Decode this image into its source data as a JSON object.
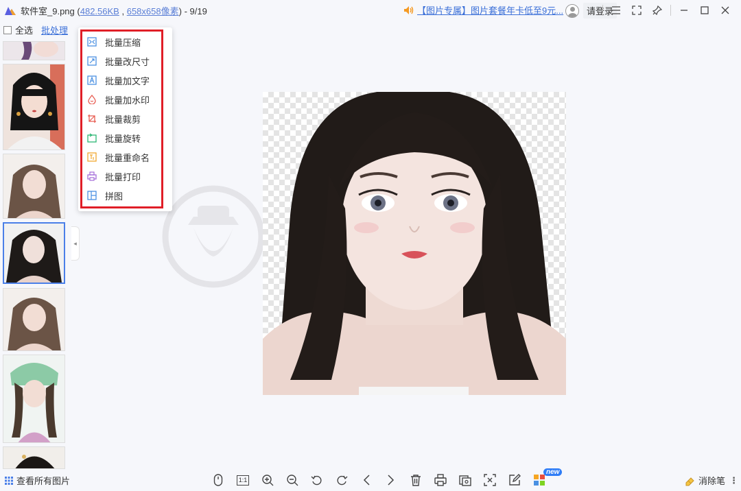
{
  "titlebar": {
    "app_name": "软件室_9.png",
    "paren_open": "(",
    "file_size": "482.56KB",
    "comma": ",",
    "dimensions": "658x658像素",
    "paren_close": ")",
    "position": "- 9/19"
  },
  "promo": {
    "text": "【图片专属】图片套餐年卡低至9元..."
  },
  "account": {
    "login_label": "请登录"
  },
  "sidebar": {
    "select_all_label": "全选",
    "batch_label": "批处理"
  },
  "batch_menu": {
    "items": [
      {
        "label": "批量压缩",
        "icon": "compress-icon",
        "color": "#4a90e2"
      },
      {
        "label": "批量改尺寸",
        "icon": "resize-icon",
        "color": "#4a90e2"
      },
      {
        "label": "批量加文字",
        "icon": "add-text-icon",
        "color": "#4a90e2"
      },
      {
        "label": "批量加水印",
        "icon": "watermark-icon",
        "color": "#e85a4f"
      },
      {
        "label": "批量裁剪",
        "icon": "crop-icon",
        "color": "#e85a4f"
      },
      {
        "label": "批量旋转",
        "icon": "rotate-icon",
        "color": "#2bb673"
      },
      {
        "label": "批量重命名",
        "icon": "rename-icon",
        "color": "#f0a830"
      },
      {
        "label": "批量打印",
        "icon": "print-icon",
        "color": "#a36cd9"
      },
      {
        "label": "拼图",
        "icon": "collage-icon",
        "color": "#4a90e2"
      }
    ]
  },
  "bottombar": {
    "view_all_label": "查看所有图片",
    "ratio_label": "1:1",
    "new_badge": "new",
    "eraser_label": "消除笔"
  },
  "colors": {
    "accent": "#3a6fd8",
    "highlight_border": "#e01e27",
    "selected_thumb": "#4a7fe8"
  }
}
